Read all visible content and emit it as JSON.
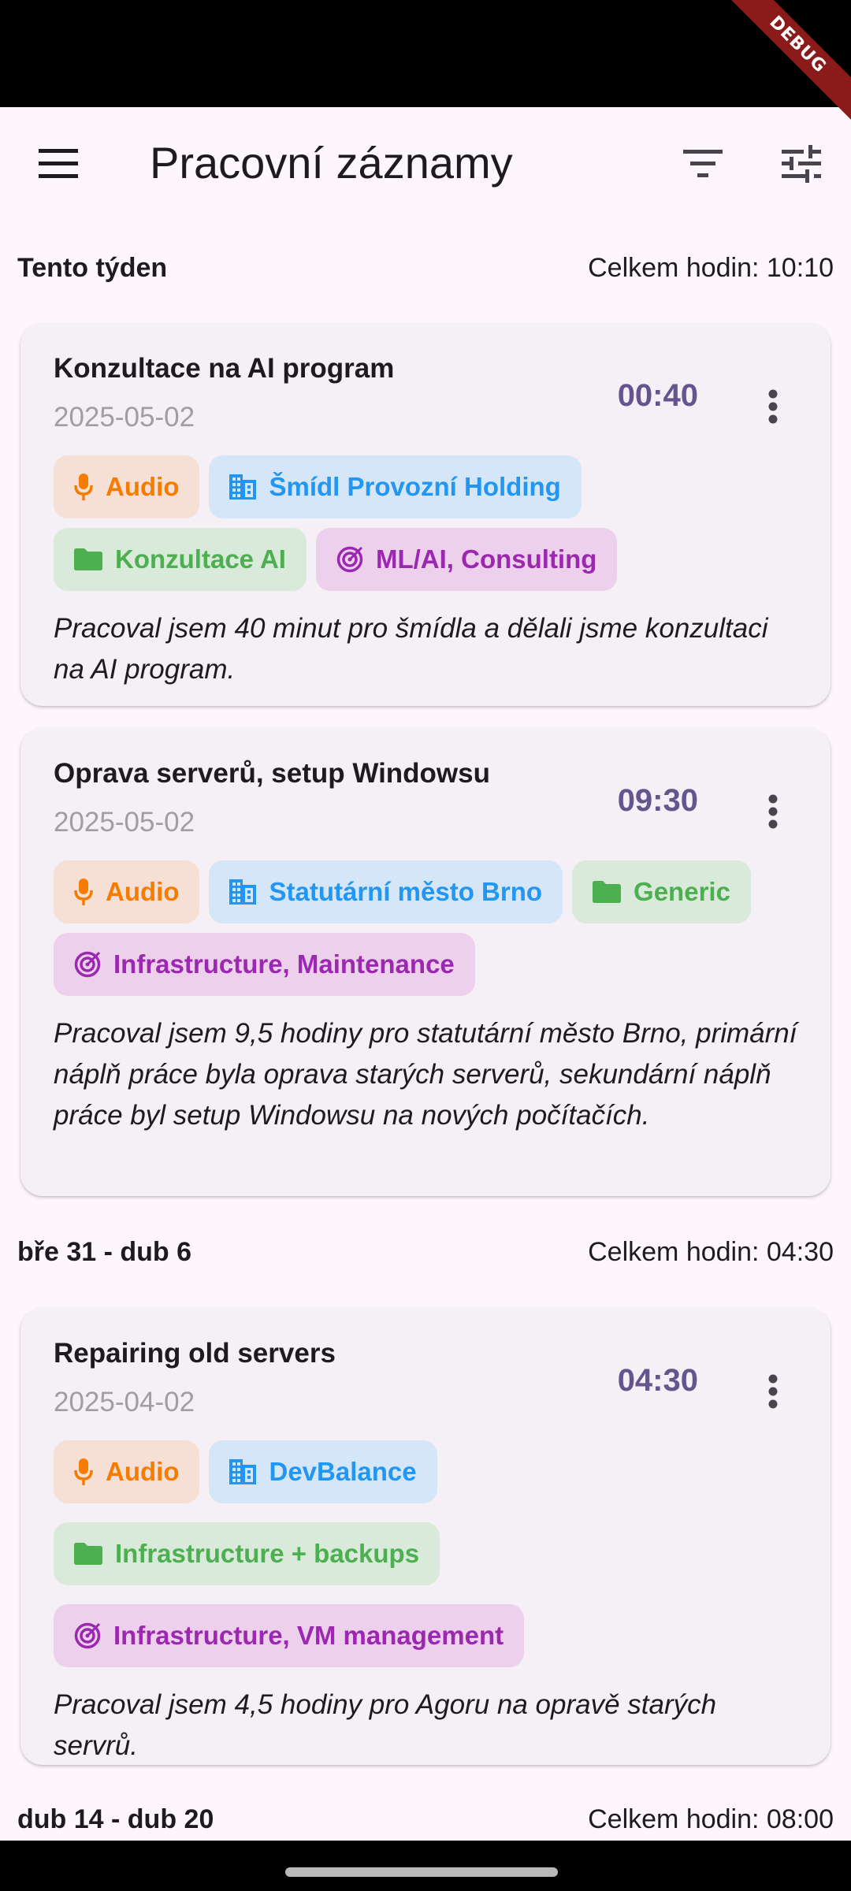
{
  "app": {
    "title": "Pracovní záznamy",
    "debug_label": "DEBUG"
  },
  "icons": {
    "menu": "menu-icon",
    "filter": "filter-icon",
    "tune": "tune-icon",
    "more": "more-vert-icon",
    "audio": "mic-icon",
    "client": "building-icon",
    "project": "folder-icon",
    "tags": "target-icon"
  },
  "colors": {
    "accent": "#65558f",
    "audio": "#f57c00",
    "client": "#2196f3",
    "project": "#4caf50",
    "tags": "#9c27b0"
  },
  "weeks": [
    {
      "range": "Tento týden",
      "total": "Celkem hodin: 10:10",
      "entries": [
        {
          "title": "Konzultace na AI program",
          "date": "2025-05-02",
          "duration": "00:40",
          "source": "Audio",
          "client": "Šmídl Provozní Holding",
          "project": "Konzultace AI",
          "tags": "ML/AI, Consulting",
          "description": "Pracoval jsem 40 minut pro šmídla a dělali jsme konzultaci na AI program."
        },
        {
          "title": "Oprava serverů, setup Windowsu",
          "date": "2025-05-02",
          "duration": "09:30",
          "source": "Audio",
          "client": "Statutární město Brno",
          "project": "Generic",
          "tags": "Infrastructure, Maintenance",
          "description": "Pracoval jsem 9,5 hodiny pro statutární město Brno, primární náplň práce byla oprava starých serverů, sekundární náplň práce byl setup Windowsu na nových počítačích."
        }
      ]
    },
    {
      "range": "bře 31 - dub 6",
      "total": "Celkem hodin: 04:30",
      "entries": [
        {
          "title": "Repairing old servers",
          "date": "2025-04-02",
          "duration": "04:30",
          "source": "Audio",
          "client": "DevBalance",
          "project": "Infrastructure + backups",
          "tags": "Infrastructure, VM management",
          "description": "Pracoval jsem 4,5 hodiny pro Agoru na opravě starých servrů."
        }
      ]
    },
    {
      "range": "dub 14 - dub 20",
      "total": "Celkem hodin: 08:00"
    }
  ]
}
